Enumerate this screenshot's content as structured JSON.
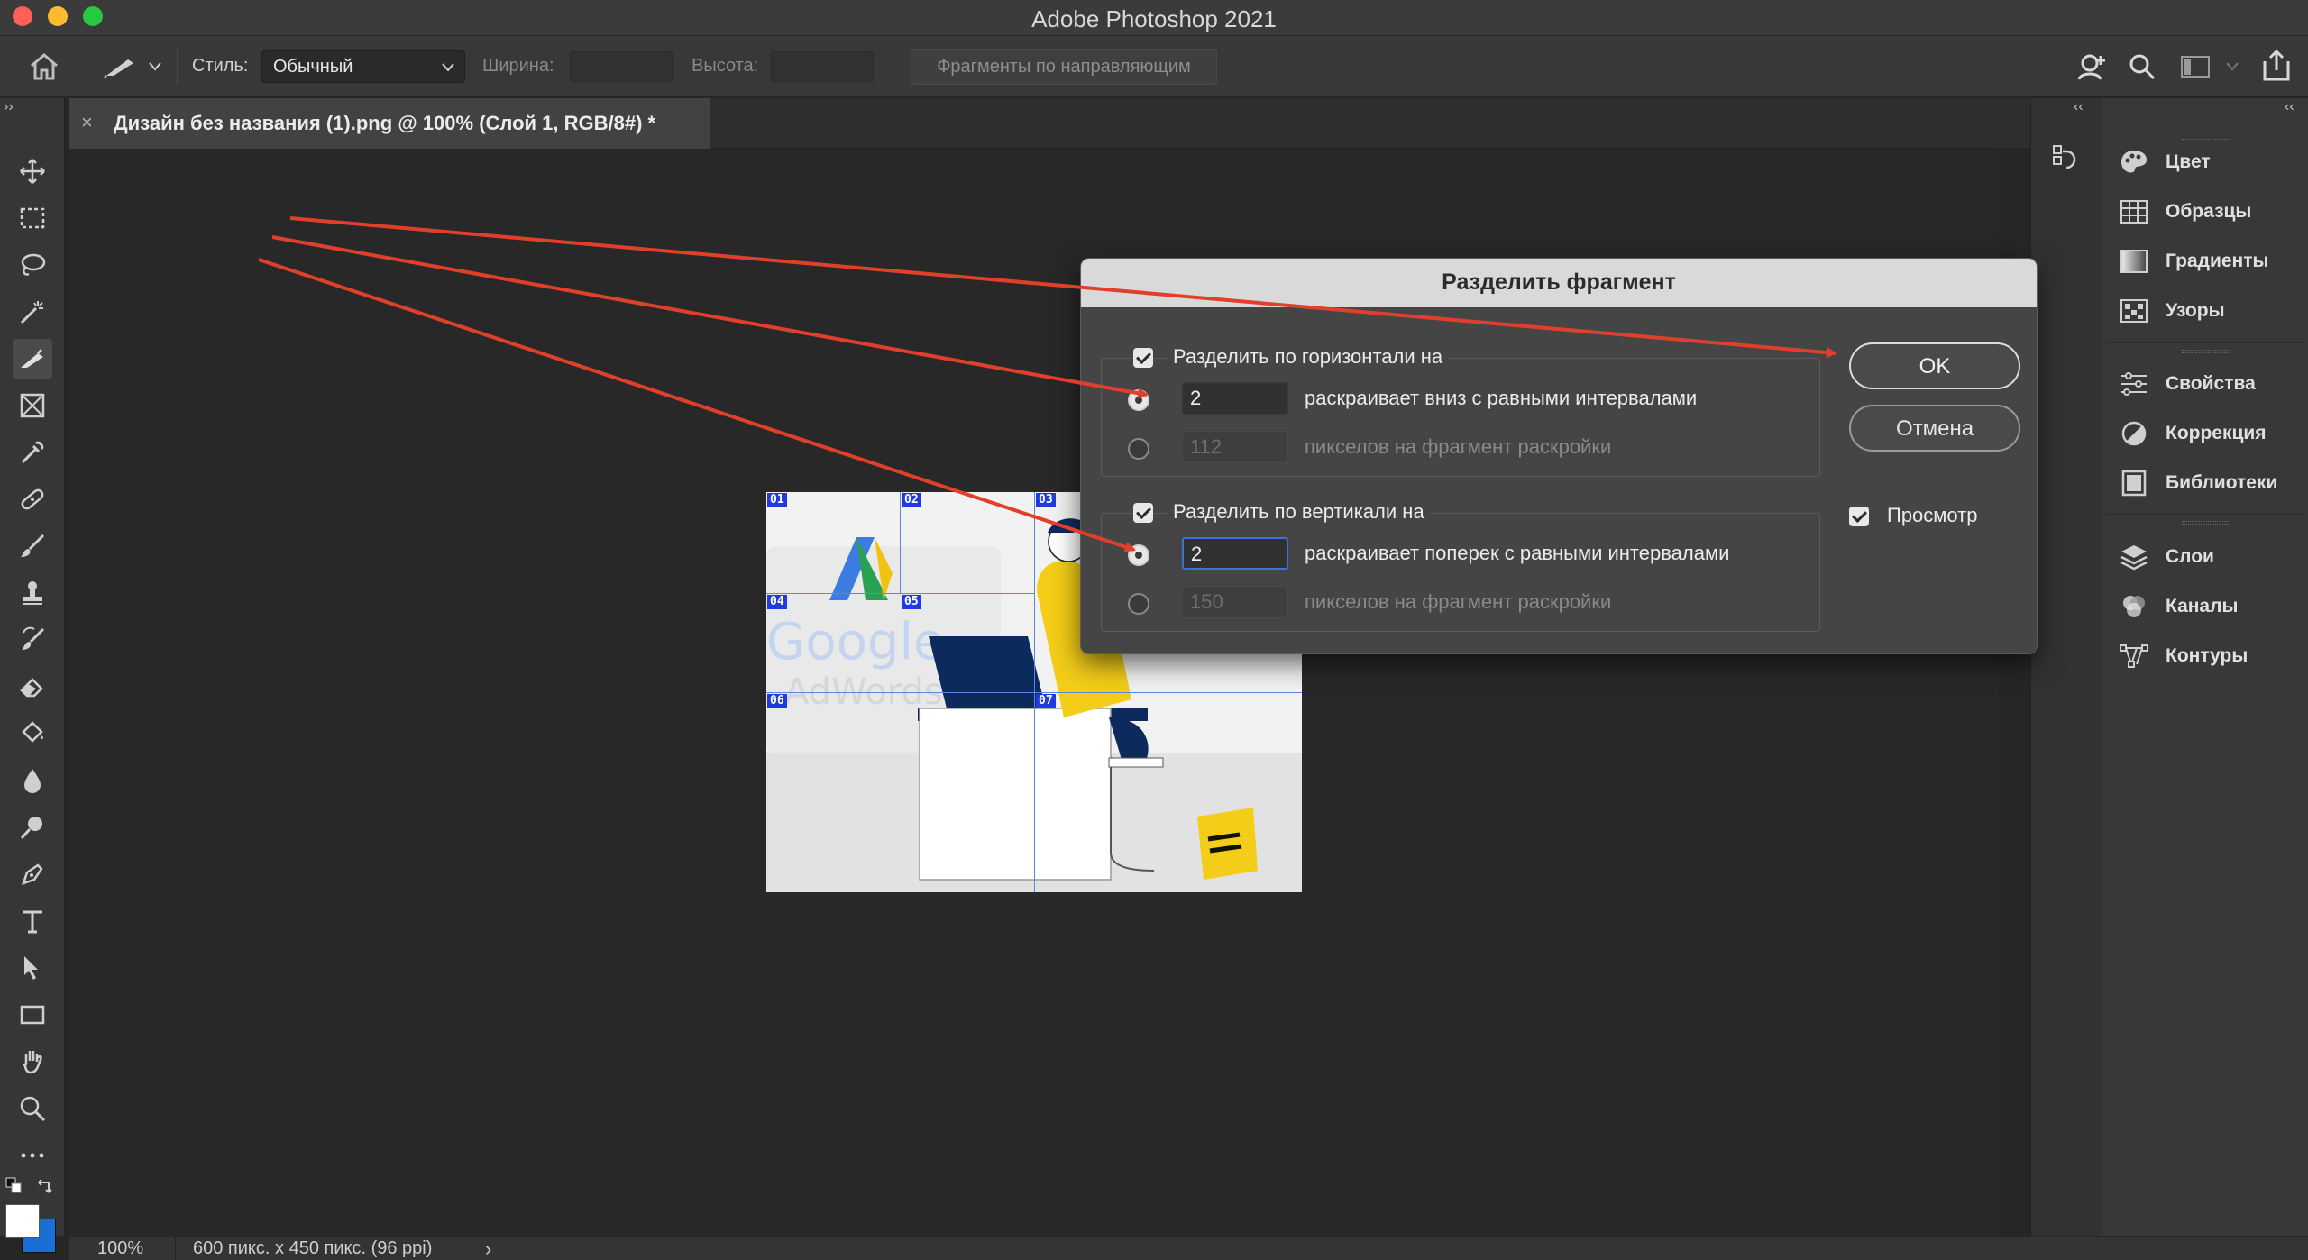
{
  "window": {
    "title": "Adobe Photoshop 2021"
  },
  "options_bar": {
    "style_label": "Стиль:",
    "style_value": "Обычный",
    "width_label": "Ширина:",
    "height_label": "Высота:",
    "guides_button": "Фрагменты по направляющим"
  },
  "document_tab": {
    "close_glyph": "×",
    "name": "Дизайн без названия (1).png @ 100% (Слой 1, RGB/8#) *"
  },
  "canvas": {
    "slice_labels": [
      "01",
      "02",
      "03",
      "04",
      "05",
      "06",
      "07"
    ]
  },
  "dialog": {
    "title": "Разделить фрагмент",
    "horizontal": {
      "label": "Разделить по горизонтали на",
      "count_value": "2",
      "count_text": "раскраивает вниз с равными интервалами",
      "pixels_value": "112",
      "pixels_text": "пикселов на фрагмент раскройки"
    },
    "vertical": {
      "label": "Разделить по вертикали на",
      "count_value": "2",
      "count_text": "раскраивает поперек с равными интервалами",
      "pixels_value": "150",
      "pixels_text": "пикселов на фрагмент раскройки"
    },
    "ok_button": "OK",
    "cancel_button": "Отмена",
    "preview_label": "Просмотр"
  },
  "right_panels": {
    "group1": [
      "Цвет",
      "Образцы",
      "Градиенты",
      "Узоры"
    ],
    "group2": [
      "Свойства",
      "Коррекция",
      "Библиотеки"
    ],
    "group3": [
      "Слои",
      "Каналы",
      "Контуры"
    ]
  },
  "status_bar": {
    "zoom": "100%",
    "doc_info": "600 пикс. x 450 пикс. (96 ppi)",
    "arrow_glyph": "›"
  },
  "colors": {
    "accent_blue": "#3b72d8",
    "slice_tag": "#1f3ae0",
    "annotation_red": "#e0402a"
  }
}
